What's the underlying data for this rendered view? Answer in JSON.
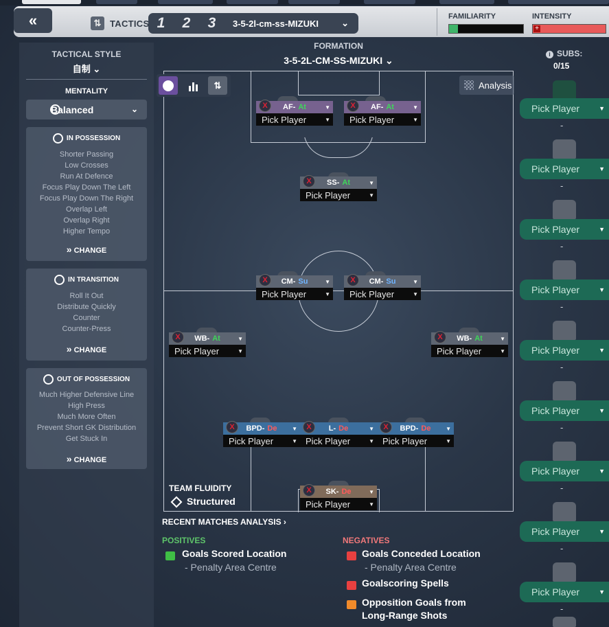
{
  "header": {
    "back_label": "«",
    "tactics_label": "TACTICS",
    "tactic_slots": [
      "1",
      "2",
      "3"
    ],
    "tactic_name": "3-5-2l-cm-ss-MIZUKI",
    "familiarity_label": "FAMILIARITY",
    "intensity_label": "INTENSITY",
    "familiarity_level": 0.12,
    "intensity_level": 0.95
  },
  "left": {
    "tactical_style_label": "TACTICAL STYLE",
    "tactical_style_value": "自制",
    "mentality_label": "MENTALITY",
    "mentality_value": "Balanced",
    "in_possession": {
      "title": "IN POSSESSION",
      "items": [
        "Shorter Passing",
        "Low Crosses",
        "Run At Defence",
        "Focus Play Down The Left",
        "Focus Play Down The Right",
        "Overlap Left",
        "Overlap Right",
        "Higher Tempo"
      ],
      "change": "CHANGE"
    },
    "in_transition": {
      "title": "IN TRANSITION",
      "items": [
        "Roll It Out",
        "Distribute Quickly",
        "Counter",
        "Counter-Press"
      ],
      "change": "CHANGE"
    },
    "out_of_possession": {
      "title": "OUT OF POSSESSION",
      "items": [
        "Much Higher Defensive Line",
        "High Press",
        "Much More Often",
        "Prevent Short GK Distribution",
        "Get Stuck In"
      ],
      "change": "CHANGE"
    }
  },
  "formation": {
    "label": "FORMATION",
    "value": "3-5-2L-CM-SS-MIZUKI",
    "analysis_label": "Analysis"
  },
  "positions": [
    {
      "role": "AF",
      "duty": "At",
      "pick": "Pick Player"
    },
    {
      "role": "AF",
      "duty": "At",
      "pick": "Pick Player"
    },
    {
      "role": "SS",
      "duty": "At",
      "pick": "Pick Player"
    },
    {
      "role": "CM",
      "duty": "Su",
      "pick": "Pick Player"
    },
    {
      "role": "CM",
      "duty": "Su",
      "pick": "Pick Player"
    },
    {
      "role": "WB",
      "duty": "At",
      "pick": "Pick Player"
    },
    {
      "role": "WB",
      "duty": "At",
      "pick": "Pick Player"
    },
    {
      "role": "BPD",
      "duty": "De",
      "pick": "Pick Player"
    },
    {
      "role": "L",
      "duty": "De",
      "pick": "Pick Player"
    },
    {
      "role": "BPD",
      "duty": "De",
      "pick": "Pick Player"
    },
    {
      "role": "SK",
      "duty": "De",
      "pick": "Pick Player"
    }
  ],
  "role_separator": " - ",
  "remove_glyph": "X",
  "subs": {
    "label": "SUBS:",
    "count": "0/15",
    "slots": [
      "Pick Player",
      "Pick Player",
      "Pick Player",
      "Pick Player",
      "Pick Player",
      "Pick Player",
      "Pick Player",
      "Pick Player",
      "Pick Player"
    ],
    "separator": "-"
  },
  "team_fluidity": {
    "label": "TEAM FLUIDITY",
    "value": "Structured"
  },
  "analysis": {
    "title": "RECENT MATCHES ANALYSIS",
    "positives_label": "POSITIVES",
    "negatives_label": "NEGATIVES",
    "positives": [
      {
        "title": "Goals Scored Location",
        "sub": "- Penalty Area Centre"
      }
    ],
    "negatives": [
      {
        "title": "Goals Conceded Location",
        "sub": "- Penalty Area Centre"
      },
      {
        "title": "Goalscoring Spells",
        "sub": ""
      },
      {
        "title": "Opposition Goals from",
        "sub": "Long-Range Shots"
      }
    ]
  },
  "colors": {
    "positive": "#5ec46a",
    "negative": "#f0787a",
    "warning": "#f08a2a",
    "sub_button": "#1d6a55"
  }
}
